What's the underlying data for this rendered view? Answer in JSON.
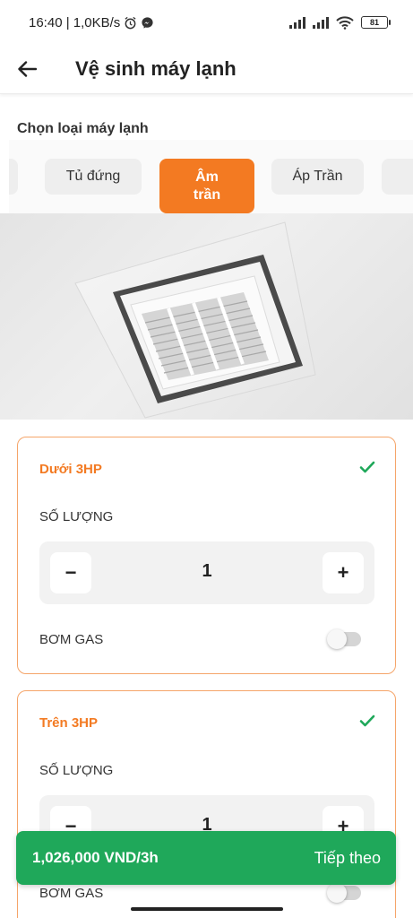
{
  "status_bar": {
    "time_speed": "16:40 | 1,0KB/s",
    "battery": "81"
  },
  "header": {
    "title": "Vệ sinh máy lạnh"
  },
  "type_section": {
    "title": "Chọn loại máy lạnh",
    "tabs": [
      {
        "label": "Tủ đứng",
        "active": false
      },
      {
        "label": "Âm trần",
        "active": true
      },
      {
        "label": "Áp Trần",
        "active": false
      }
    ]
  },
  "options": [
    {
      "title": "Dưới 3HP",
      "selected": true,
      "quantity_label": "SỐ LƯỢNG",
      "quantity": "1",
      "minus": "−",
      "plus": "+",
      "gas_label": "BƠM GAS",
      "gas_enabled": false
    },
    {
      "title": "Trên 3HP",
      "selected": true,
      "quantity_label": "SỐ LƯỢNG",
      "quantity": "1",
      "minus": "−",
      "plus": "+",
      "gas_label": "BƠM GAS",
      "gas_enabled": false
    }
  ],
  "footer": {
    "price": "1,026,000 VND/3h",
    "next_label": "Tiếp theo"
  },
  "colors": {
    "accent": "#f37a22",
    "success": "#1fa85a",
    "card_border": "#f5a56a"
  },
  "icons": {
    "back": "arrow-left-icon",
    "check": "check-icon",
    "alarm": "alarm-icon",
    "messenger": "messenger-icon",
    "wifi": "wifi-icon"
  }
}
